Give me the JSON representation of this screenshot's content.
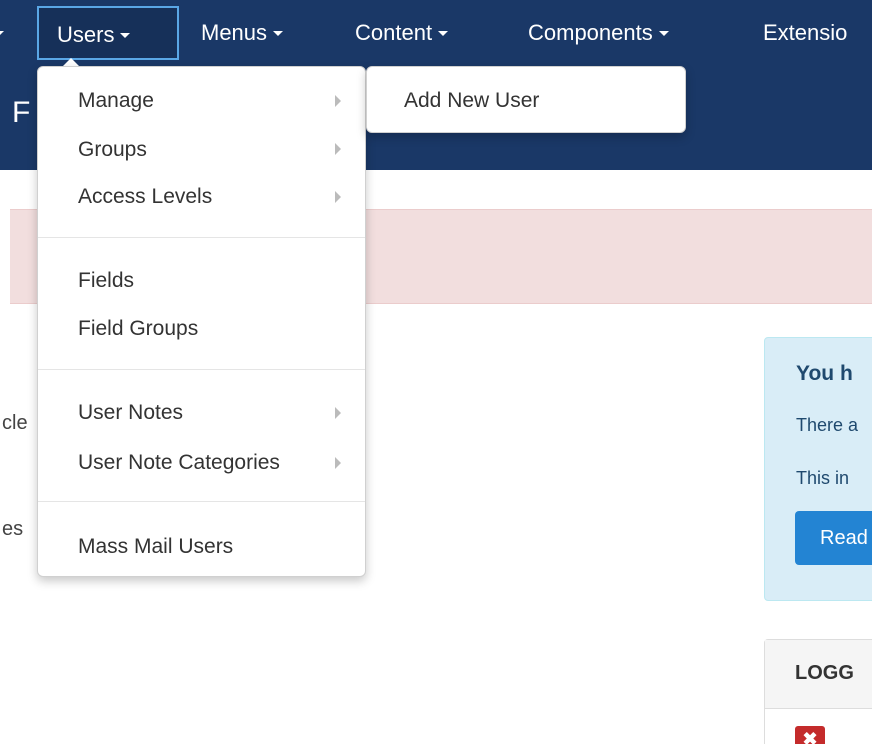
{
  "nav": {
    "items": [
      {
        "label": "Users"
      },
      {
        "label": "Menus"
      },
      {
        "label": "Content"
      },
      {
        "label": "Components"
      },
      {
        "label": "Extensio"
      }
    ]
  },
  "header": {
    "title_fragment": "F"
  },
  "background": {
    "fragment_1": "cle",
    "fragment_2": "es"
  },
  "users_menu": {
    "items": [
      {
        "label": "Manage",
        "has_submenu": true
      },
      {
        "label": "Groups",
        "has_submenu": true
      },
      {
        "label": "Access Levels",
        "has_submenu": true
      },
      {
        "label": "Fields",
        "has_submenu": false
      },
      {
        "label": "Field Groups",
        "has_submenu": false
      },
      {
        "label": "User Notes",
        "has_submenu": true
      },
      {
        "label": "User Note Categories",
        "has_submenu": true
      },
      {
        "label": "Mass Mail Users",
        "has_submenu": false
      }
    ]
  },
  "submenu": {
    "items": [
      {
        "label": "Add New User"
      }
    ]
  },
  "info_panel": {
    "heading": "You h",
    "line_1": "There a",
    "line_2": "This in",
    "button_label": "Read"
  },
  "logged_panel": {
    "title": "LOGG",
    "close_glyph": "✖"
  },
  "colors": {
    "navbar": "#1a3867",
    "alert_bg": "#f2dede",
    "info_bg": "#d9edf7",
    "primary_button": "#2384d3",
    "danger": "#c42b2b"
  }
}
